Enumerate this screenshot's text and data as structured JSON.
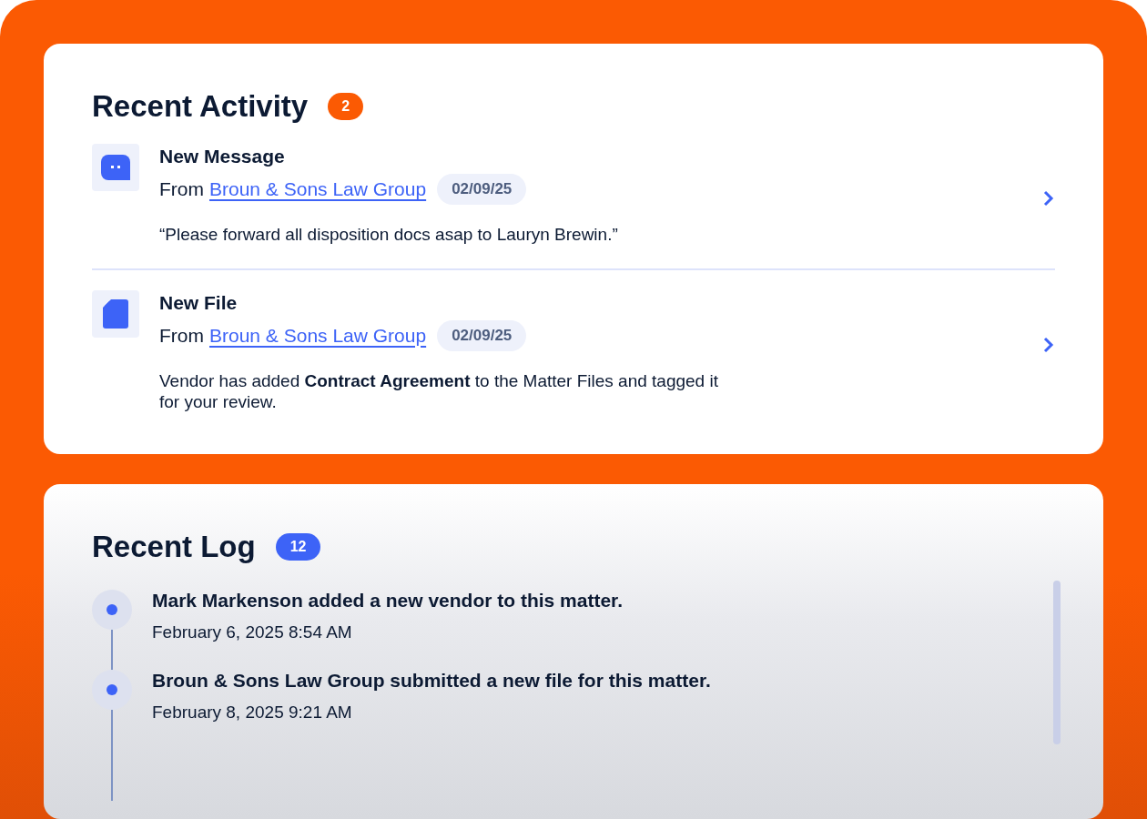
{
  "activity": {
    "title": "Recent Activity",
    "count": "2",
    "items": [
      {
        "kind": "message",
        "title": "New Message",
        "from_label": "From",
        "sender": "Broun & Sons Law Group",
        "date": "02/09/25",
        "body": "“Please forward all disposition docs asap to Lauryn Brewin.”"
      },
      {
        "kind": "file",
        "title": "New File",
        "from_label": "From",
        "sender": "Broun & Sons Law Group",
        "date": "02/09/25",
        "body": "Vendor has added **Contract Agreement** to the Matter Files and tagged it for your review."
      }
    ]
  },
  "log": {
    "title": "Recent Log",
    "count": "12",
    "entries": [
      {
        "text": "Mark Markenson added a new vendor to this matter.",
        "time": "February 6, 2025 8:54 AM"
      },
      {
        "text": "Broun & Sons Law Group submitted a new file for this matter.",
        "time": "February 8, 2025 9:21 AM"
      }
    ]
  }
}
